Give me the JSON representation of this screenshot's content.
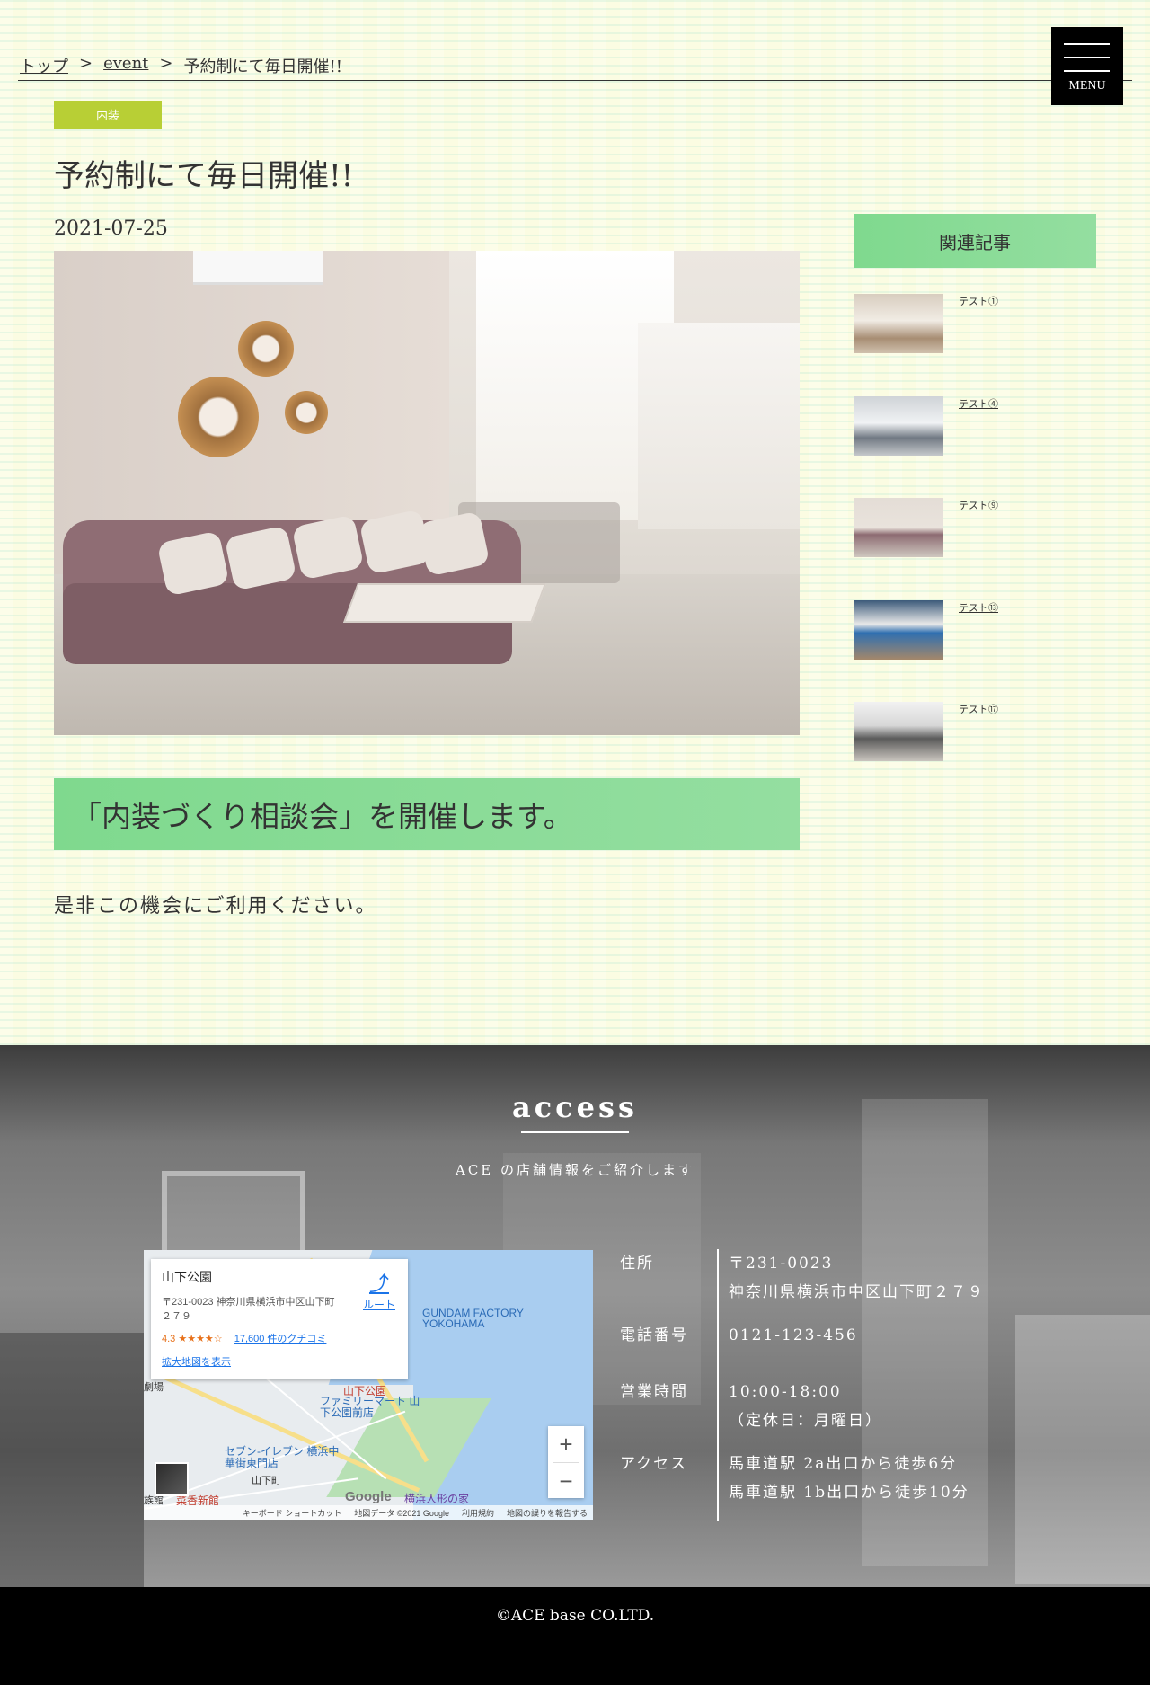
{
  "breadcrumb": {
    "top": "トップ",
    "event": "event",
    "sep1": ">",
    "sep2": ">",
    "current": "予約制にて毎日開催!!"
  },
  "menu": {
    "label": "MENU"
  },
  "post": {
    "category": "内装",
    "title": "予約制にて毎日開催!!",
    "date": "2021-07-25",
    "heading": "「内装づくり相談会」を開催します。",
    "body": "是非この機会にご利用ください。"
  },
  "sidebar": {
    "heading": "関連記事",
    "items": [
      {
        "caption": "テスト①"
      },
      {
        "caption": "テスト④"
      },
      {
        "caption": "テスト⑨"
      },
      {
        "caption": "テスト⑬"
      },
      {
        "caption": "テスト⑰"
      }
    ]
  },
  "access": {
    "title": "access",
    "subtitle": "ACE の店舗情報をご紹介します",
    "map": {
      "place_name": "山下公園",
      "address": "〒231-0023 神奈川県横浜市中区山下町２７９",
      "rating": "4.3 ★★★★☆",
      "reviews": "17,600 件のクチコミ",
      "larger_map": "拡大地図を表示",
      "route": "ルート",
      "labels": {
        "gundam": "GUNDAM FACTORY YOKOHAMA",
        "park": "山下公園",
        "familymart": "ファミリーマート 山下公園前店",
        "seven": "セブン-イレブン 横浜中華街東門店",
        "yamashita_cho": "山下町",
        "dolls": "横浜人形の家",
        "shinkan": "菜香新館",
        "gekijo": "劇場",
        "zoku": "族館"
      },
      "zoom_in": "+",
      "zoom_out": "−",
      "google": "Google",
      "attribution": {
        "shortcuts": "キーボード ショートカット",
        "mapdata": "地図データ ©2021 Google",
        "terms": "利用規約",
        "report": "地図の誤りを報告する"
      }
    },
    "info": [
      {
        "key": "住所",
        "lines": [
          "〒231-0023",
          "神奈川県横浜市中区山下町２７９"
        ]
      },
      {
        "key": "電話番号",
        "lines": [
          "0121-123-456"
        ]
      },
      {
        "key": "営業時間",
        "lines": [
          "10:00-18:00",
          "（定休日：月曜日）"
        ]
      },
      {
        "key": "アクセス",
        "lines": [
          "馬車道駅 2a出口から徒歩6分",
          "馬車道駅 1b出口から徒歩10分"
        ]
      }
    ]
  },
  "footer": {
    "copyright": "©ACE base CO.LTD."
  },
  "colors": {
    "badge": "#b8cf35",
    "band": "#7fd98e",
    "page_bg": "#fbfce2",
    "footer_bg": "#000000"
  }
}
